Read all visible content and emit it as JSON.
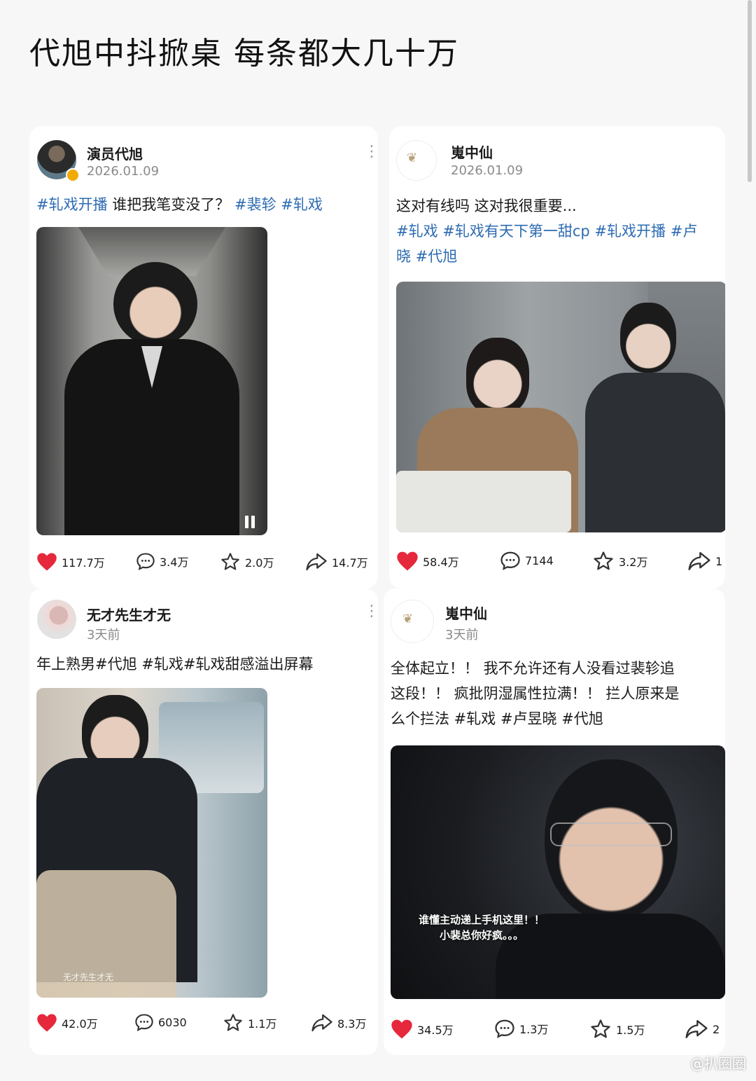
{
  "title": "代旭中抖掀桌 每条都大几十万",
  "watermark": "@扒圈圈",
  "posts": [
    {
      "author": "演员代旭",
      "date": "2026.01.09",
      "text": [
        [
          "#轧戏开播",
          "tag"
        ],
        [
          "  谁把我笔变没了？",
          "plain"
        ],
        [
          " #裴轸",
          "tag"
        ],
        [
          " #轧戏",
          "tag"
        ]
      ],
      "stats": {
        "likes": "117.7万",
        "comments": "3.4万",
        "favs": "2.0万",
        "shares": "14.7万"
      }
    },
    {
      "author": "嵬中仙",
      "date": "2026.01.09",
      "text_line1": "这对有线吗 这对我很重要...",
      "text_line2": "#轧戏 #轧戏有天下第一甜cp #轧戏开播 #卢",
      "text_line3": "晓 #代旭",
      "stats": {
        "likes": "58.4万",
        "comments": "7144",
        "favs": "3.2万",
        "shares": "1"
      }
    },
    {
      "author": "无才先生才无",
      "date": "3天前",
      "text": "年上熟男#代旭 #轧戏#轧戏甜感溢出屏幕",
      "photo_mark": "无才先生才无",
      "stats": {
        "likes": "42.0万",
        "comments": "6030",
        "favs": "1.1万",
        "shares": "8.3万"
      }
    },
    {
      "author": "嵬中仙",
      "date": "3天前",
      "text_line1": "全体起立！！ 我不允许还有人没看过裴轸追",
      "text_line2": "这段！！ 疯批阴湿属性拉满！！ 拦人原来是",
      "text_line3": "么个拦法 #轧戏 #卢昱晓 #代旭",
      "subtitle_line1": "谁懂主动递上手机这里！！",
      "subtitle_line2": "小裴总你好疯。。。",
      "stats": {
        "likes": "34.5万",
        "comments": "1.3万",
        "favs": "1.5万",
        "shares": "2"
      }
    }
  ],
  "colors": {
    "heart": "#e5283c",
    "tag": "#2c6bb2"
  }
}
